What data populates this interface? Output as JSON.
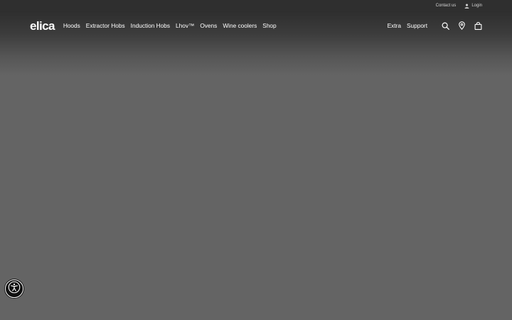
{
  "topbar": {
    "contact_label": "Contact us",
    "login_label": "Login",
    "login_icon": "user-icon"
  },
  "nav": {
    "logo_text": "elica",
    "items": [
      "Hoods",
      "Extractor Hobs",
      "Induction Hobs",
      "Lhov™",
      "Ovens",
      "Wine coolers",
      "Shop"
    ],
    "right_items": [
      "Extra",
      "Support"
    ],
    "icons": [
      "search-icon",
      "location-pin-icon",
      "shopping-bag-icon"
    ]
  },
  "accessibility": {
    "icon": "accessibility-icon"
  },
  "colors": {
    "topbar_bg": "#2f2f2f",
    "page_bg": "#646464",
    "text": "#ffffff"
  }
}
